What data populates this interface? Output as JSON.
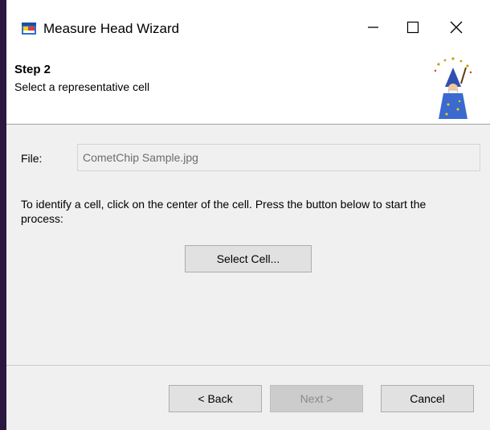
{
  "window": {
    "title": "Measure Head Wizard",
    "controls": {
      "minimize_icon": "minimize-icon",
      "maximize_icon": "maximize-icon",
      "close_icon": "close-icon"
    }
  },
  "header": {
    "step": "Step 2",
    "subtitle": "Select a representative cell"
  },
  "form": {
    "file_label": "File:",
    "file_value": "CometChip Sample.jpg",
    "instructions": "To identify a cell, click on the center of the cell. Press the button below to start the process:",
    "select_button": "Select Cell..."
  },
  "footer": {
    "back_label": "< Back",
    "next_label": "Next >",
    "cancel_label": "Cancel"
  },
  "colors": {
    "disabled_text": "#6d6d6d",
    "button_face": "#e1e1e1",
    "dialog_background": "#f0f0f0"
  }
}
